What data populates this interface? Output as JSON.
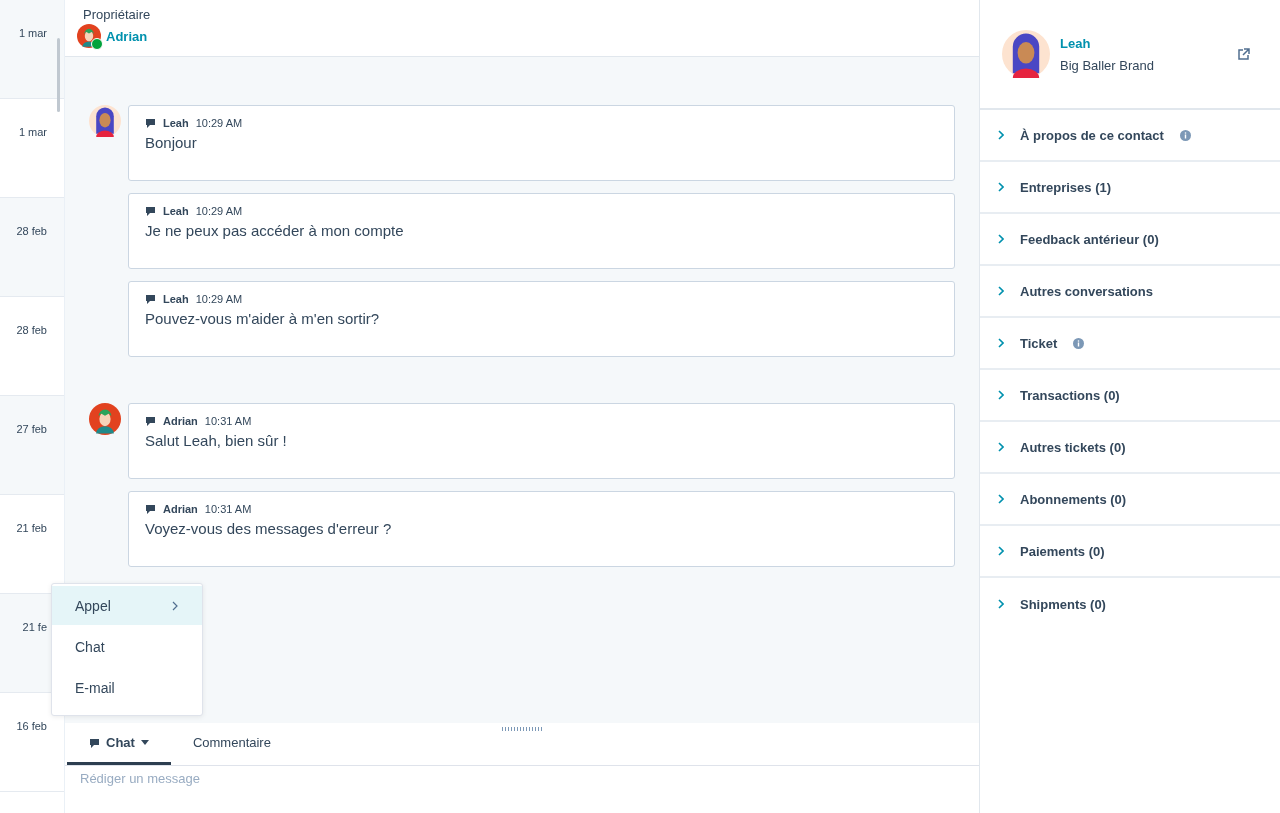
{
  "timeline": {
    "dates": [
      "1 mar",
      "1 mar",
      "28 feb",
      "28 feb",
      "27 feb",
      "21 feb",
      "21 fe",
      "16 feb"
    ]
  },
  "header": {
    "label": "Propriétaire",
    "owner": "Adrian",
    "online": true
  },
  "groups": [
    {
      "kind": "contact",
      "messages": [
        {
          "author": "Leah",
          "time": "10:29 AM",
          "text": "Bonjour"
        },
        {
          "author": "Leah",
          "time": "10:29 AM",
          "text": "Je ne peux pas accéder à mon compte"
        },
        {
          "author": "Leah",
          "time": "10:29 AM",
          "text": "Pouvez-vous m'aider à m'en sortir?"
        }
      ]
    },
    {
      "kind": "agent",
      "messages": [
        {
          "author": "Adrian",
          "time": "10:31 AM",
          "text": "Salut Leah, bien sûr !"
        },
        {
          "author": "Adrian",
          "time": "10:31 AM",
          "text": "Voyez-vous des messages d'erreur ?"
        }
      ]
    }
  ],
  "menu": {
    "items": [
      {
        "label": "Appel",
        "selected": true,
        "submenu": true
      },
      {
        "label": "Chat",
        "selected": false,
        "submenu": false
      },
      {
        "label": "E-mail",
        "selected": false,
        "submenu": false
      }
    ]
  },
  "composer": {
    "tabs": [
      {
        "label": "Chat",
        "selected": true,
        "dropdown": true
      },
      {
        "label": "Commentaire",
        "selected": false,
        "dropdown": false
      }
    ],
    "placeholder": "Rédiger un message"
  },
  "contact": {
    "name": "Leah",
    "company": "Big Baller Brand"
  },
  "sections": [
    {
      "title": "À propos de ce contact",
      "info": true
    },
    {
      "title": "Entreprises (1)",
      "info": false
    },
    {
      "title": "Feedback antérieur (0)",
      "info": false
    },
    {
      "title": "Autres conversations",
      "info": false
    },
    {
      "title": "Ticket",
      "info": true
    },
    {
      "title": "Transactions (0)",
      "info": false
    },
    {
      "title": "Autres tickets (0)",
      "info": false
    },
    {
      "title": "Abonnements (0)",
      "info": false
    },
    {
      "title": "Paiements (0)",
      "info": false
    },
    {
      "title": "Shipments (0)",
      "info": false
    }
  ]
}
